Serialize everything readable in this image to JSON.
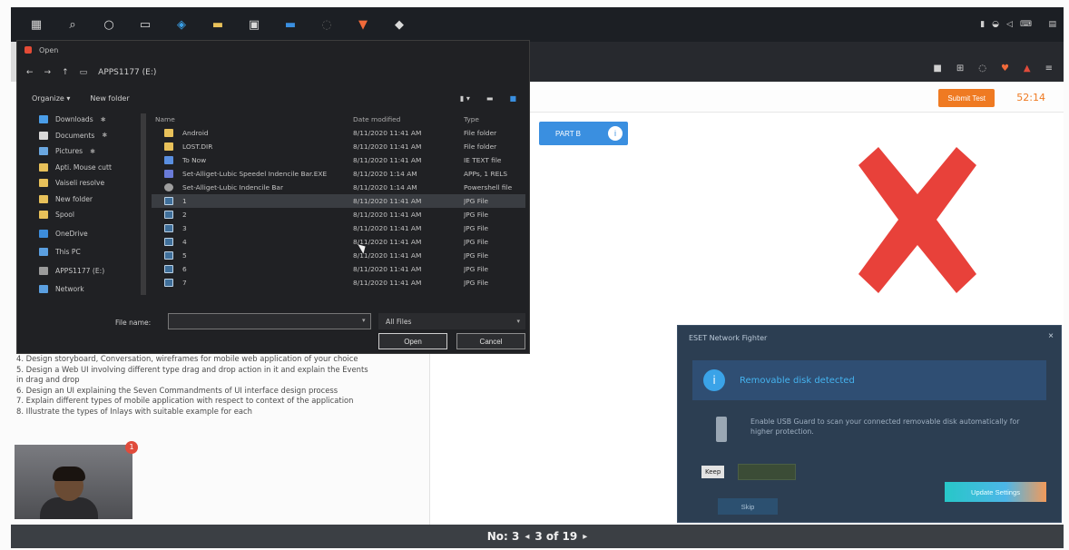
{
  "taskbar": {
    "icons": [
      "windows-icon",
      "search-icon",
      "cortana-icon",
      "task-view-icon",
      "edge-icon",
      "file-explorer-icon",
      "store-icon",
      "mail-icon",
      "browser-icon",
      "brave-icon",
      "app-icon"
    ]
  },
  "browser": {
    "url": "",
    "icons": [
      "extension-icon",
      "bookmark-icon",
      "sync-icon",
      "brave-shield-icon",
      "notification-icon",
      "menu-icon"
    ]
  },
  "exam": {
    "submit_label": "Submit Test",
    "timer": "52:14",
    "part_label": "PART B",
    "part_info": "i",
    "questions": [
      "4. Design storyboard, Conversation, wireframes for mobile web application of your choice",
      "5. Design a Web UI involving different type drag and drop action in it and explain the Events",
      "in drag and drop",
      "6. Design an UI explaining the Seven Commandments of UI interface design process",
      "7. Explain different types of mobile application with respect to context of the application",
      "8. Illustrate the types of Inlays with suitable example for each"
    ],
    "cam_badge": "1"
  },
  "pager": {
    "label": "No: 3",
    "prev": "◂",
    "position": "3 of 19",
    "next": "▸"
  },
  "dialog": {
    "title": "Open",
    "path": "APPS1177 (E:)",
    "cmd_organize": "Organize ▾",
    "cmd_new_folder": "New folder",
    "nav_items": [
      {
        "label": "Downloads",
        "color": "#4a9de8",
        "pinned": true
      },
      {
        "label": "Documents",
        "color": "#d8d8d8",
        "pinned": true
      },
      {
        "label": "Pictures",
        "color": "#6aa7e0",
        "pinned": true
      },
      {
        "label": "Apti. Mouse cutt",
        "color": "#e8c15a",
        "pinned": false
      },
      {
        "label": "Vaiseli resolve",
        "color": "#e8c15a",
        "pinned": false
      },
      {
        "label": "New folder",
        "color": "#e8c15a",
        "pinned": false
      },
      {
        "label": "Spool",
        "color": "#e8c15a",
        "pinned": false
      },
      {
        "label": "",
        "color": "",
        "pinned": false
      },
      {
        "label": "OneDrive",
        "color": "#3d8ddc",
        "pinned": false
      },
      {
        "label": "",
        "color": "",
        "pinned": false
      },
      {
        "label": "This PC",
        "color": "#5b9fe0",
        "pinned": false
      },
      {
        "label": "",
        "color": "",
        "pinned": false
      },
      {
        "label": "APPS1177 (E:)",
        "color": "#9b9b9b",
        "pinned": false
      },
      {
        "label": "",
        "color": "",
        "pinned": false
      },
      {
        "label": "Network",
        "color": "#5b9fe0",
        "pinned": false
      }
    ],
    "columns": {
      "name": "Name",
      "date": "Date modified",
      "type": "Type"
    },
    "files": [
      {
        "icon": "folder",
        "name": "Android",
        "date": "8/11/2020 11:41 AM",
        "type": "File folder",
        "selected": false
      },
      {
        "icon": "folder",
        "name": "LOST.DIR",
        "date": "8/11/2020 11:41 AM",
        "type": "File folder",
        "selected": false
      },
      {
        "icon": "doc",
        "name": "To Now",
        "date": "8/11/2020 11:41 AM",
        "type": "IE TEXT file",
        "selected": false
      },
      {
        "icon": "setup",
        "name": "Set-Alliget-Lubic Speedel Indencile Bar.EXE",
        "date": "8/11/2020 1:14 AM",
        "type": "APPs, 1 RELS",
        "selected": false
      },
      {
        "icon": "gear",
        "name": "Set-Alliget-Lubic Indencile Bar",
        "date": "8/11/2020 1:14 AM",
        "type": "Powershell file",
        "selected": false
      },
      {
        "icon": "image",
        "name": "1",
        "date": "8/11/2020 11:41 AM",
        "type": "JPG File",
        "selected": true
      },
      {
        "icon": "image",
        "name": "2",
        "date": "8/11/2020 11:41 AM",
        "type": "JPG File",
        "selected": false
      },
      {
        "icon": "image",
        "name": "3",
        "date": "8/11/2020 11:41 AM",
        "type": "JPG File",
        "selected": false
      },
      {
        "icon": "image",
        "name": "4",
        "date": "8/11/2020 11:41 AM",
        "type": "JPG File",
        "selected": false
      },
      {
        "icon": "image",
        "name": "5",
        "date": "8/11/2020 11:41 AM",
        "type": "JPG File",
        "selected": false
      },
      {
        "icon": "image",
        "name": "6",
        "date": "8/11/2020 11:41 AM",
        "type": "JPG File",
        "selected": false
      },
      {
        "icon": "image",
        "name": "7",
        "date": "8/11/2020 11:41 AM",
        "type": "JPG File",
        "selected": false
      }
    ],
    "filename_label": "File name:",
    "filename_value": "",
    "filetype_value": "All Files",
    "open_label": "Open",
    "cancel_label": "Cancel"
  },
  "notification": {
    "title": "ESET Network Fighter",
    "close": "×",
    "status": "Removable disk detected",
    "description": "Enable USB Guard to scan your connected removable disk automatically for higher protection.",
    "checkbox_label": "Keep",
    "secondary_label": "Skip",
    "primary_label": "Update Settings"
  }
}
